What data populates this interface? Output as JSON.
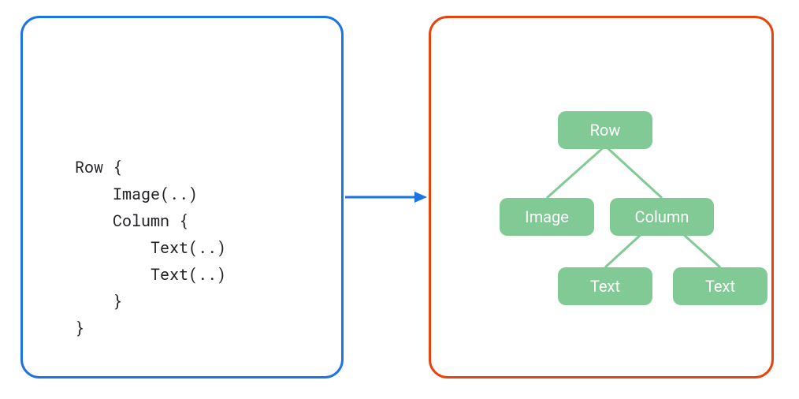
{
  "code": {
    "line1": "Row {",
    "line2": "    Image(..)",
    "line3": "    Column {",
    "line4": "        Text(..)",
    "line5": "        Text(..)",
    "line6": "    }",
    "line7": "}"
  },
  "tree": {
    "root": "Row",
    "child1": "Image",
    "child2": "Column",
    "leaf1": "Text",
    "leaf2": "Text"
  },
  "colors": {
    "left_border": "#1a73e8",
    "right_border": "#e8430d",
    "node": "#81C995",
    "arrow": "#1a73e8"
  }
}
